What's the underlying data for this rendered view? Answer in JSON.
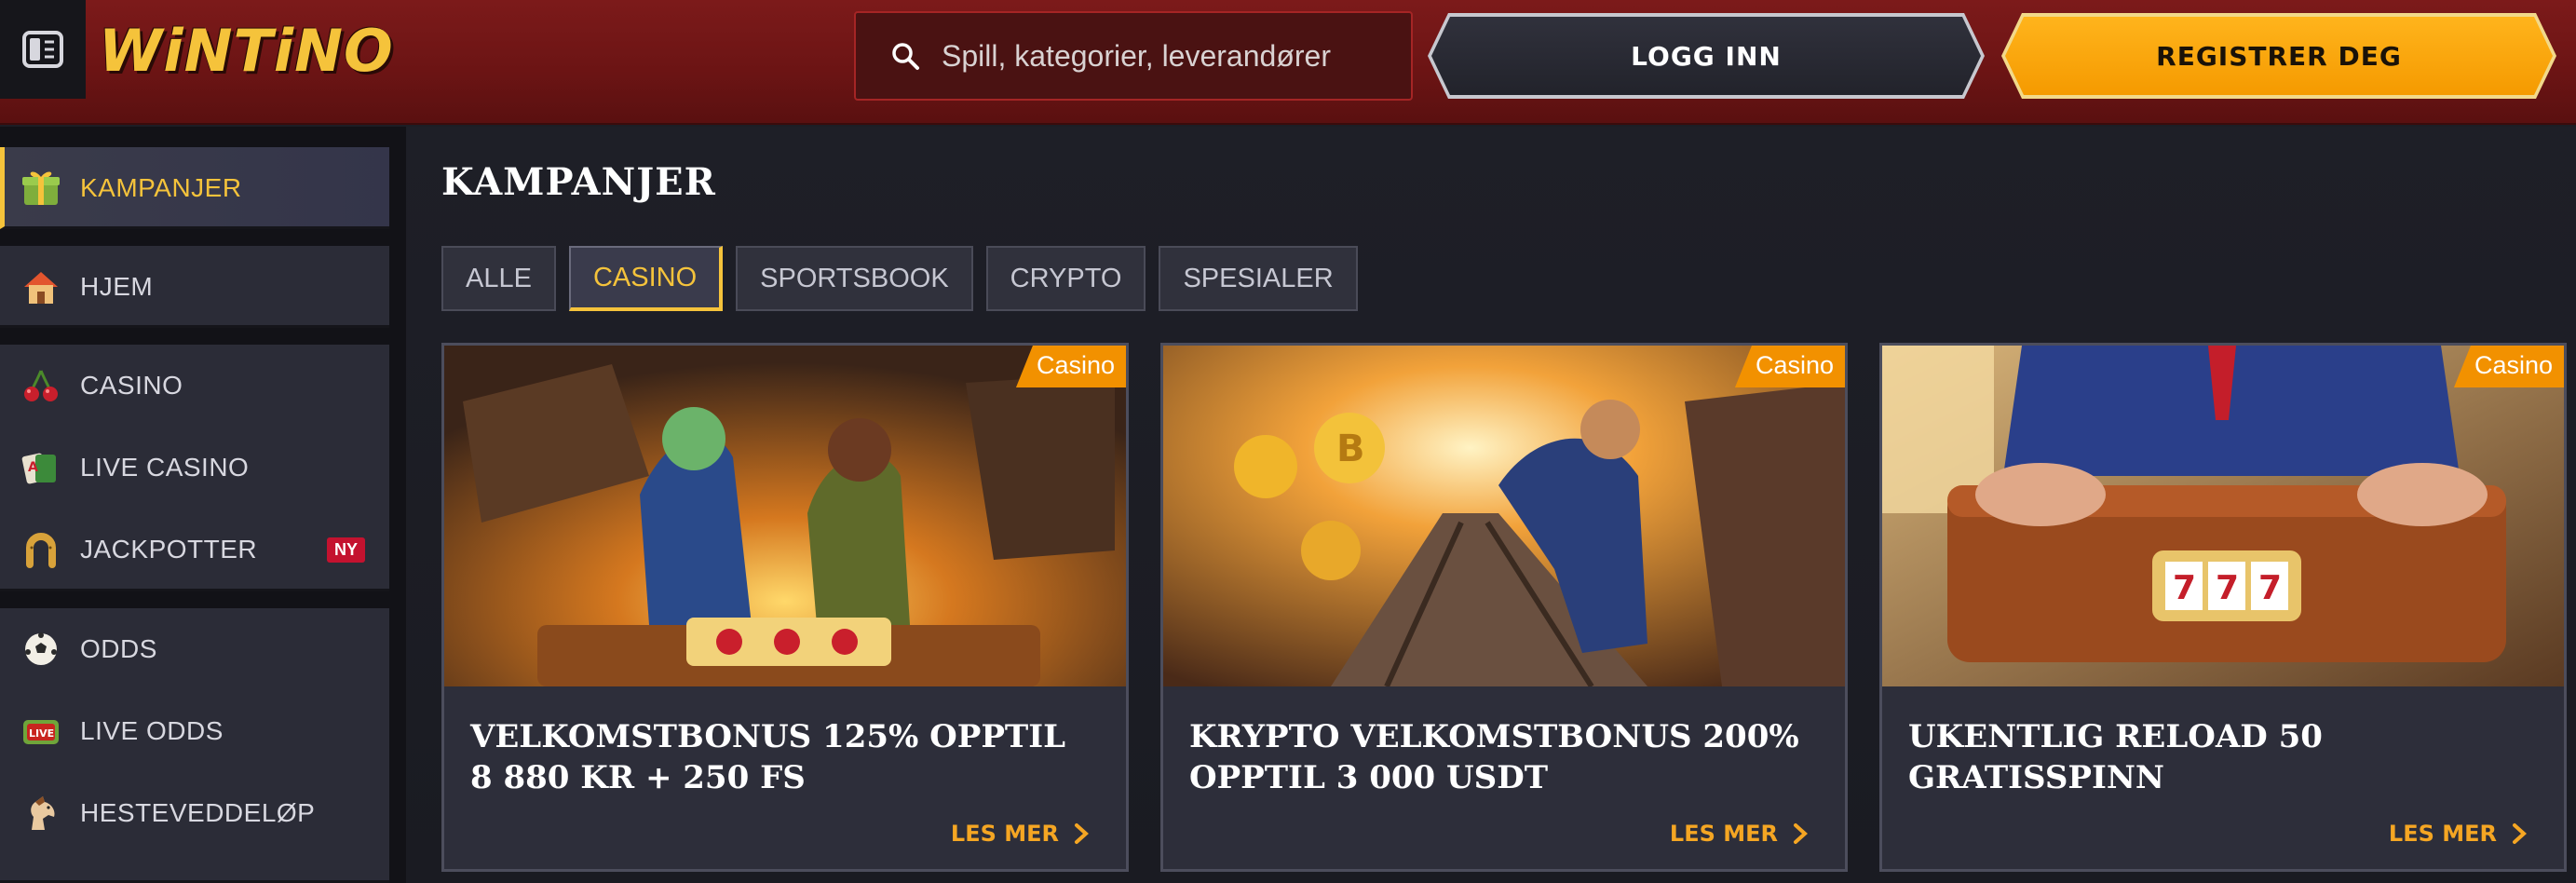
{
  "header": {
    "logo_text": "WiNTiNO",
    "search": {
      "placeholder": "Spill, kategorier, leverandører"
    },
    "login_label": "LOGG INN",
    "register_label": "REGISTRER DEG",
    "colors": {
      "accent": "#f5c33b",
      "header_bg": "#7c1a1a",
      "register_bg": "#ffb41c"
    }
  },
  "sidebar": {
    "items": [
      {
        "label": "KAMPANJER",
        "icon": "gift-icon",
        "active": true
      },
      {
        "label": "HJEM",
        "icon": "home-icon"
      },
      {
        "label": "CASINO",
        "icon": "cherry-icon"
      },
      {
        "label": "LIVE CASINO",
        "icon": "cards-icon"
      },
      {
        "label": "JACKPOTTER",
        "icon": "horseshoe-icon",
        "badge": "NY"
      },
      {
        "label": "ODDS",
        "icon": "soccer-ball-icon"
      },
      {
        "label": "LIVE ODDS",
        "icon": "live-icon"
      },
      {
        "label": "HESTEVEDDELØP",
        "icon": "horse-icon"
      }
    ]
  },
  "main": {
    "title": "KAMPANJER",
    "filters": [
      "ALLE",
      "CASINO",
      "SPORTSBOOK",
      "CRYPTO",
      "SPESIALER"
    ],
    "active_filter": "CASINO",
    "cards": [
      {
        "tag": "Casino",
        "title": "VELKOMSTBONUS 125% OPPTIL\n8 880 KR + 250 FS",
        "more": "LES MER",
        "image": "two-cowboys-slot-machine-image"
      },
      {
        "tag": "Casino",
        "title": "KRYPTO VELKOMSTBONUS 200%\nOPPTIL 3 000 USDT",
        "more": "LES MER",
        "image": "running-man-crypto-coins-image"
      },
      {
        "tag": "Casino",
        "title": "UKENTLIG RELOAD 50 GRATISSPINN",
        "more": "LES MER",
        "image": "suitcase-777-slot-image"
      }
    ]
  }
}
